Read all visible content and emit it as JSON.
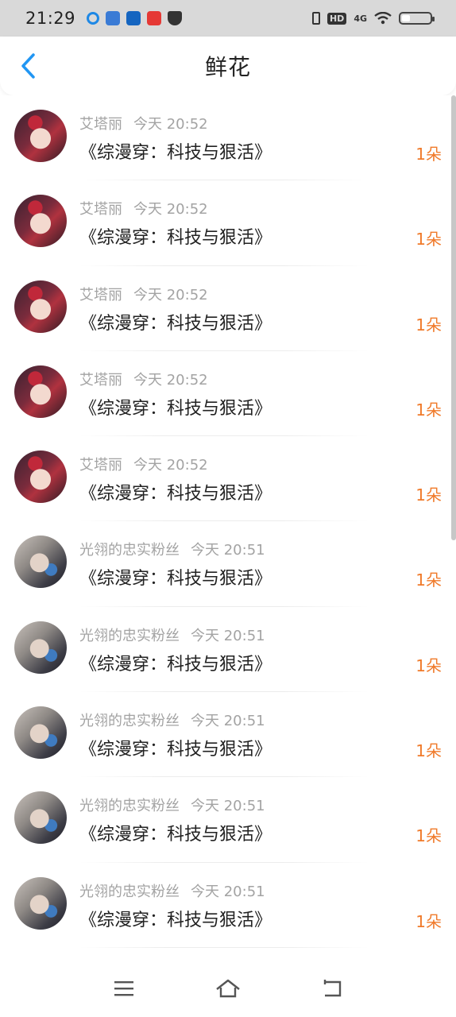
{
  "status_bar": {
    "time": "21:29",
    "network": "4G",
    "hd": "HD",
    "battery_level": 0.3
  },
  "header": {
    "title": "鲜花",
    "back_icon": "chevron-left-icon",
    "accent_color": "#2196f3"
  },
  "list": {
    "items": [
      {
        "user": "艾塔丽",
        "time": "今天  20:52",
        "book": "《综漫穿：科技与狠活》",
        "amount": "1朵",
        "avatar": "a1"
      },
      {
        "user": "艾塔丽",
        "time": "今天  20:52",
        "book": "《综漫穿：科技与狠活》",
        "amount": "1朵",
        "avatar": "a1"
      },
      {
        "user": "艾塔丽",
        "time": "今天  20:52",
        "book": "《综漫穿：科技与狠活》",
        "amount": "1朵",
        "avatar": "a1"
      },
      {
        "user": "艾塔丽",
        "time": "今天  20:52",
        "book": "《综漫穿：科技与狠活》",
        "amount": "1朵",
        "avatar": "a1"
      },
      {
        "user": "艾塔丽",
        "time": "今天  20:52",
        "book": "《综漫穿：科技与狠活》",
        "amount": "1朵",
        "avatar": "a1"
      },
      {
        "user": "光翎的忠实粉丝",
        "time": "今天  20:51",
        "book": "《综漫穿：科技与狠活》",
        "amount": "1朵",
        "avatar": "a2"
      },
      {
        "user": "光翎的忠实粉丝",
        "time": "今天  20:51",
        "book": "《综漫穿：科技与狠活》",
        "amount": "1朵",
        "avatar": "a2"
      },
      {
        "user": "光翎的忠实粉丝",
        "time": "今天  20:51",
        "book": "《综漫穿：科技与狠活》",
        "amount": "1朵",
        "avatar": "a2"
      },
      {
        "user": "光翎的忠实粉丝",
        "time": "今天  20:51",
        "book": "《综漫穿：科技与狠活》",
        "amount": "1朵",
        "avatar": "a2"
      },
      {
        "user": "光翎的忠实粉丝",
        "time": "今天  20:51",
        "book": "《综漫穿：科技与狠活》",
        "amount": "1朵",
        "avatar": "a2"
      }
    ],
    "amount_color": "#f07a2a"
  },
  "bottom_nav": {
    "items": [
      "menu-icon",
      "home-icon",
      "back-icon"
    ]
  }
}
